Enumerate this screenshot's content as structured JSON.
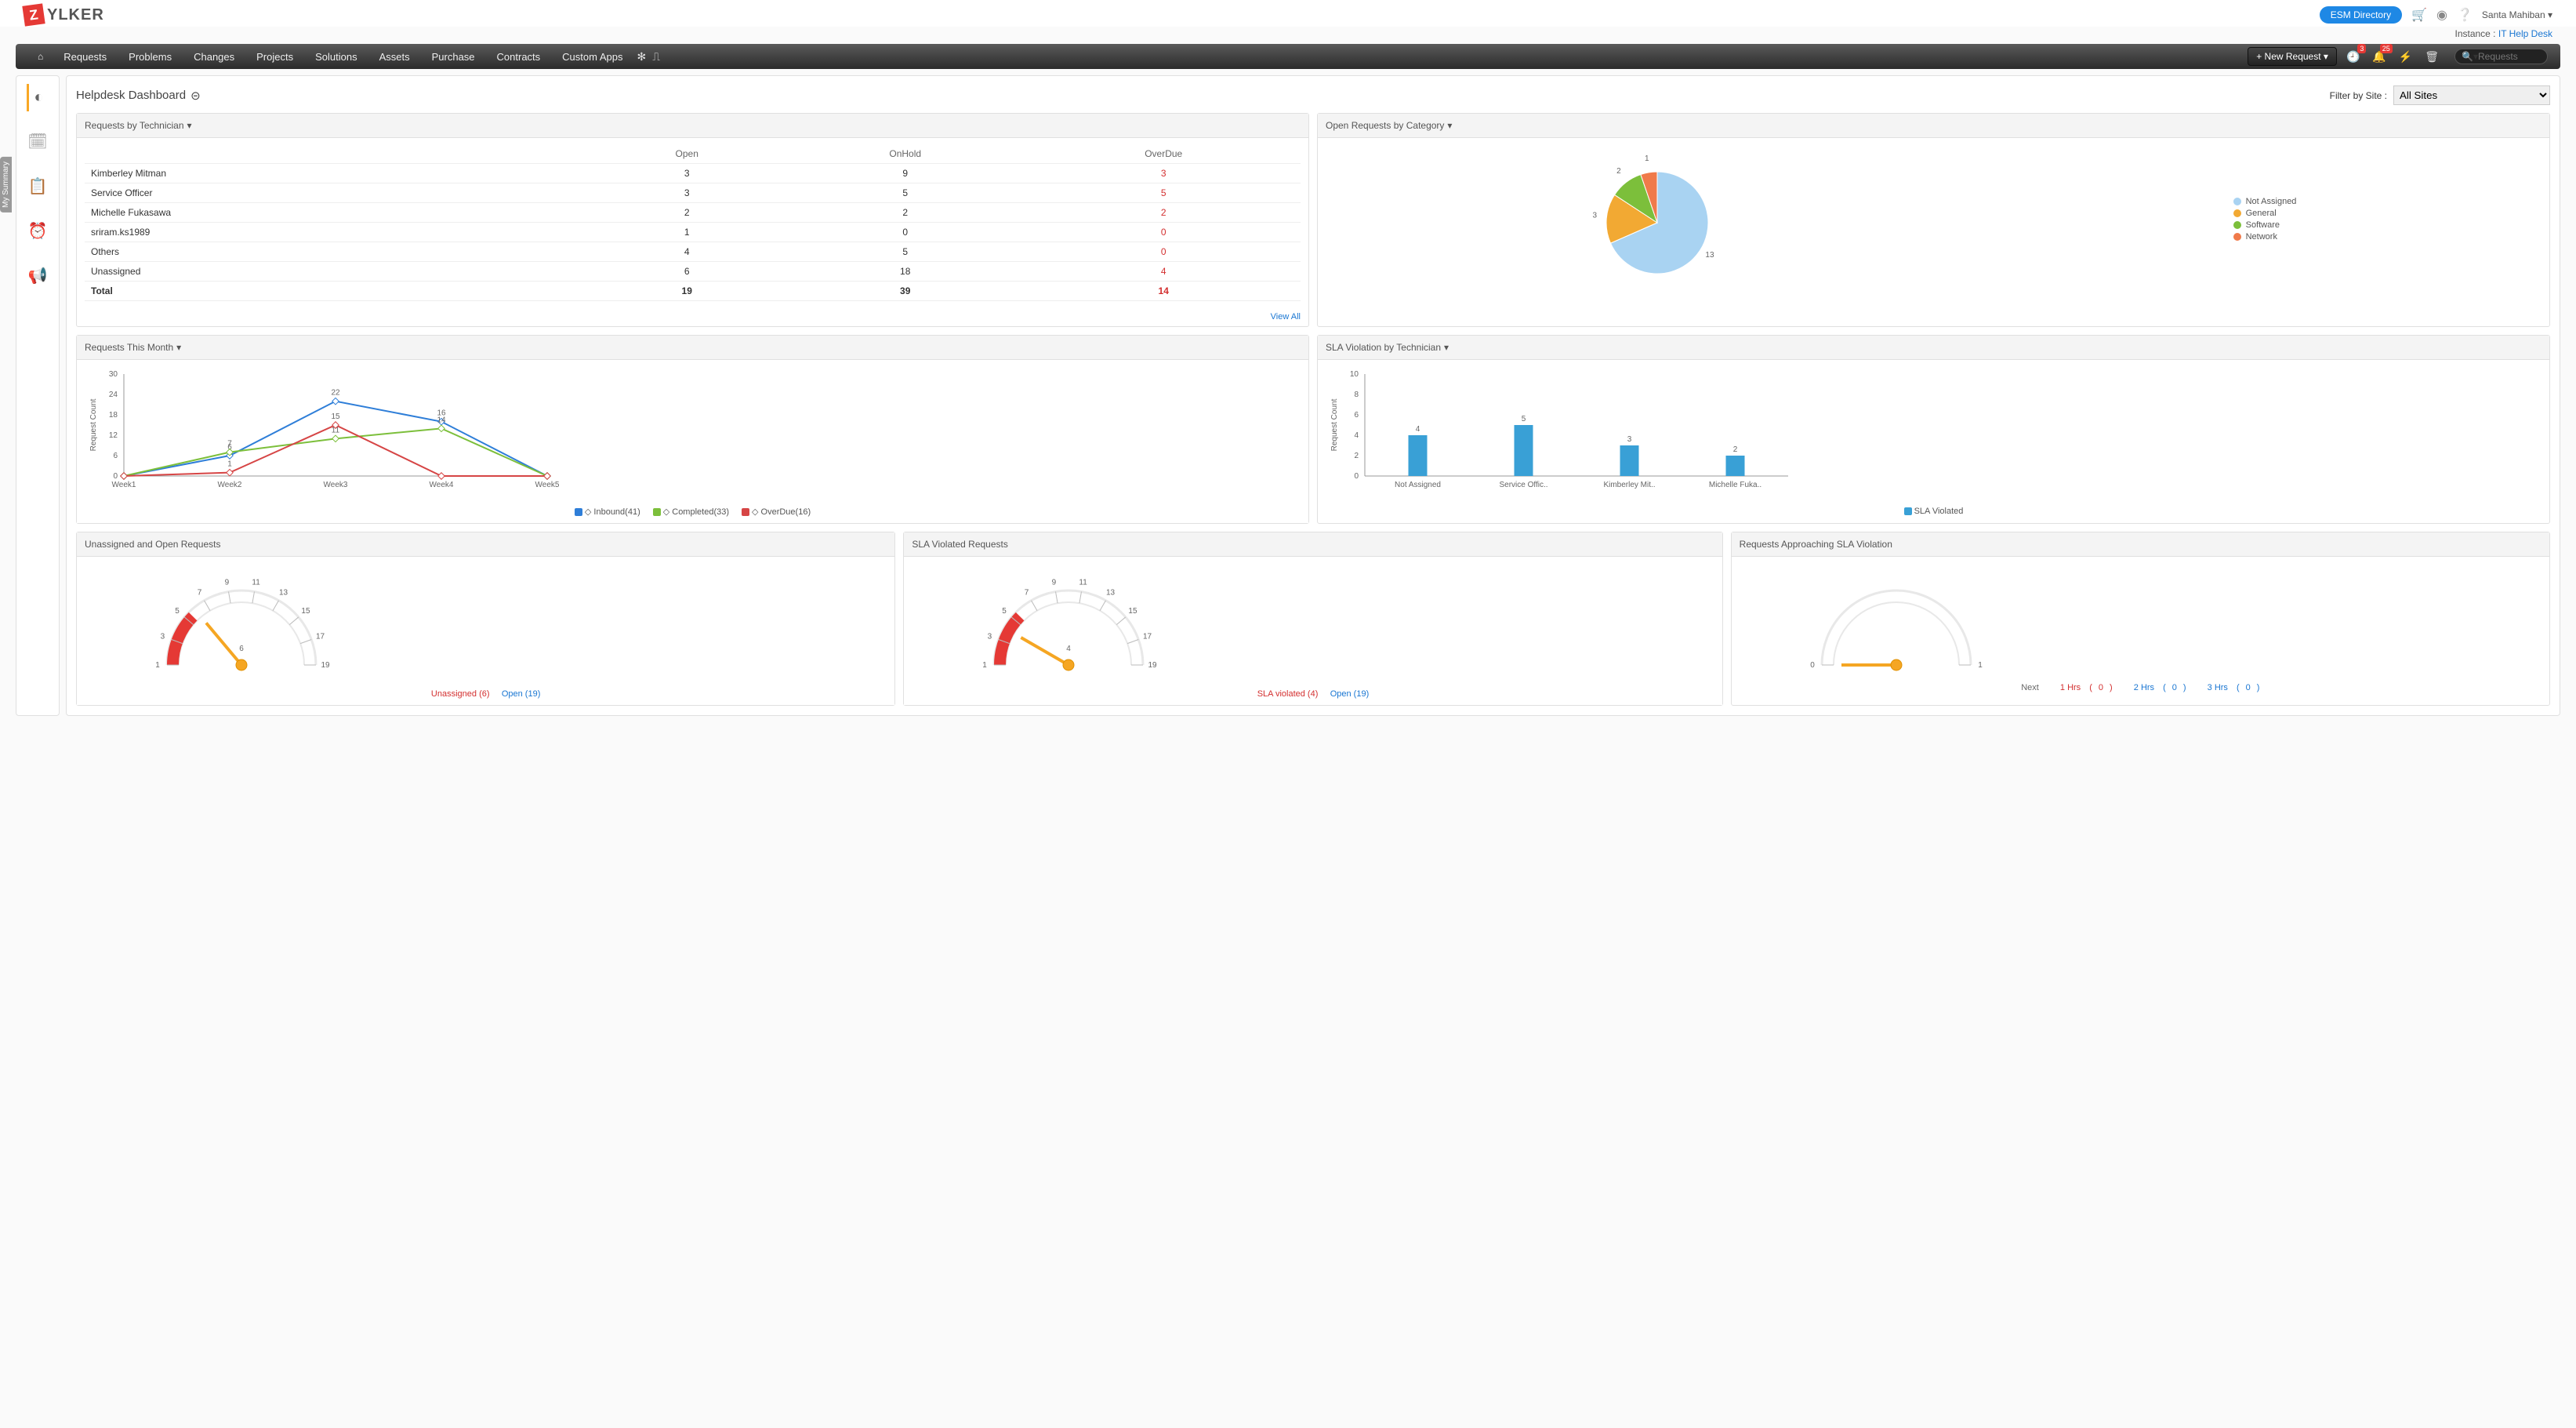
{
  "header": {
    "logo_text": "YLKER",
    "logo_letter": "Z",
    "esm_btn": "ESM Directory",
    "username": "Santa Mahiban",
    "instance_label": "Instance :",
    "instance_name": "IT Help Desk"
  },
  "nav": {
    "items": [
      "Requests",
      "Problems",
      "Changes",
      "Projects",
      "Solutions",
      "Assets",
      "Purchase",
      "Contracts",
      "Custom Apps"
    ],
    "new_request": "+ New Request",
    "badge_clock": "3",
    "badge_bell": "25",
    "search_placeholder": "Requests"
  },
  "sidebar": {
    "my_summary": "My Summary"
  },
  "dashboard": {
    "title": "Helpdesk Dashboard",
    "filter_label": "Filter by Site :",
    "filter_value": "All Sites"
  },
  "widgets": {
    "req_by_tech": {
      "title": "Requests by Technician",
      "headers": [
        "",
        "Open",
        "OnHold",
        "OverDue"
      ],
      "rows": [
        {
          "name": "Kimberley Mitman",
          "open": "3",
          "onhold": "9",
          "overdue": "3"
        },
        {
          "name": "Service Officer",
          "open": "3",
          "onhold": "5",
          "overdue": "5"
        },
        {
          "name": "Michelle Fukasawa",
          "open": "2",
          "onhold": "2",
          "overdue": "2"
        },
        {
          "name": "sriram.ks1989",
          "open": "1",
          "onhold": "0",
          "overdue": "0"
        },
        {
          "name": "Others",
          "open": "4",
          "onhold": "5",
          "overdue": "0"
        },
        {
          "name": "Unassigned",
          "open": "6",
          "onhold": "18",
          "overdue": "4"
        }
      ],
      "total": {
        "name": "Total",
        "open": "19",
        "onhold": "39",
        "overdue": "14"
      },
      "view_all": "View All"
    },
    "open_by_cat": {
      "title": "Open Requests by Category",
      "legend": [
        {
          "label": "Not Assigned",
          "color": "#a9d3f2"
        },
        {
          "label": "General",
          "color": "#f2a933"
        },
        {
          "label": "Software",
          "color": "#7cbf3b"
        },
        {
          "label": "Network",
          "color": "#f07a4a"
        }
      ]
    },
    "req_month": {
      "title": "Requests This Month",
      "ylabel": "Request Count",
      "legend_inbound": "Inbound(41)",
      "legend_completed": "Completed(33)",
      "legend_overdue": "OverDue(16)"
    },
    "sla_tech": {
      "title": "SLA Violation by Technician",
      "ylabel": "Request Count",
      "legend": "SLA Violated"
    },
    "unassigned_open": {
      "title": "Unassigned and Open Requests",
      "label_unassigned": "Unassigned",
      "val_unassigned": "6",
      "label_open": "Open",
      "val_open": "19"
    },
    "sla_violated": {
      "title": "SLA Violated Requests",
      "label_violated": "SLA violated",
      "val_violated": "4",
      "label_open": "Open",
      "val_open": "19"
    },
    "approaching": {
      "title": "Requests Approaching SLA Violation",
      "next_label": "Next",
      "h1": "1 Hrs",
      "v1": "0",
      "h2": "2 Hrs",
      "v2": "0",
      "h3": "3 Hrs",
      "v3": "0"
    }
  },
  "chart_data": [
    {
      "id": "open_by_category_pie",
      "type": "pie",
      "title": "Open Requests by Category",
      "series": [
        {
          "name": "Not Assigned",
          "value": 13,
          "color": "#a9d3f2"
        },
        {
          "name": "General",
          "value": 3,
          "color": "#f2a933"
        },
        {
          "name": "Software",
          "value": 2,
          "color": "#7cbf3b"
        },
        {
          "name": "Network",
          "value": 1,
          "color": "#f07a4a"
        }
      ]
    },
    {
      "id": "requests_this_month_line",
      "type": "line",
      "title": "Requests This Month",
      "xlabel": "",
      "ylabel": "Request Count",
      "categories": [
        "Week1",
        "Week2",
        "Week3",
        "Week4",
        "Week5"
      ],
      "ylim": [
        0,
        30
      ],
      "yticks": [
        0,
        6,
        12,
        18,
        24,
        30
      ],
      "series": [
        {
          "name": "Inbound",
          "total": 41,
          "color": "#2e7ed8",
          "values": [
            0,
            6,
            22,
            16,
            0
          ]
        },
        {
          "name": "Completed",
          "total": 33,
          "color": "#7cbf3b",
          "values": [
            0,
            7,
            11,
            14,
            0
          ]
        },
        {
          "name": "OverDue",
          "total": 16,
          "color": "#d64545",
          "values": [
            0,
            1,
            15,
            0,
            0
          ]
        }
      ]
    },
    {
      "id": "sla_violation_by_tech_bar",
      "type": "bar",
      "title": "SLA Violation by Technician",
      "xlabel": "",
      "ylabel": "Request Count",
      "ylim": [
        0,
        10
      ],
      "yticks": [
        0,
        2,
        4,
        6,
        8,
        10
      ],
      "categories": [
        "Not Assigned",
        "Service Offic..",
        "Kimberley Mit..",
        "Michelle Fuka.."
      ],
      "series": [
        {
          "name": "SLA Violated",
          "color": "#39a0d6",
          "values": [
            4,
            5,
            3,
            2
          ]
        }
      ]
    },
    {
      "id": "unassigned_open_gauge",
      "type": "gauge",
      "title": "Unassigned and Open Requests",
      "scale_min": 1,
      "scale_max": 19,
      "ticks": [
        1,
        3,
        5,
        7,
        9,
        11,
        13,
        15,
        17,
        19
      ],
      "value": 6,
      "labels": {
        "Unassigned": 6,
        "Open": 19
      }
    },
    {
      "id": "sla_violated_gauge",
      "type": "gauge",
      "title": "SLA Violated Requests",
      "scale_min": 1,
      "scale_max": 19,
      "ticks": [
        1,
        3,
        5,
        7,
        9,
        11,
        13,
        15,
        17,
        19
      ],
      "value": 4,
      "labels": {
        "SLA violated": 4,
        "Open": 19
      }
    },
    {
      "id": "approaching_sla_gauge",
      "type": "gauge",
      "title": "Requests Approaching SLA Violation",
      "scale_min": 0,
      "scale_max": 1,
      "ticks": [
        0,
        1
      ],
      "value": 0,
      "labels": {
        "1 Hrs": 0,
        "2 Hrs": 0,
        "3 Hrs": 0
      }
    }
  ]
}
